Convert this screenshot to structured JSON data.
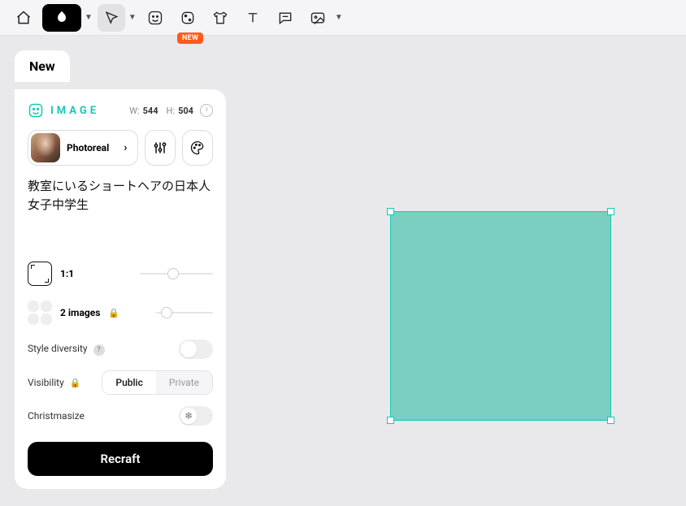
{
  "toolbar": {
    "new_badge": "NEW"
  },
  "tab": {
    "label": "New"
  },
  "panel": {
    "mode_label": "IMAGE",
    "width_label": "W:",
    "width_value": "544",
    "height_label": "H:",
    "height_value": "504",
    "style_name": "Photoreal",
    "prompt": "教室にいるショートヘアの日本人女子中学生",
    "aspect_label": "1:1",
    "images_count_label": "2 images",
    "style_diversity_label": "Style diversity",
    "visibility_label": "Visibility",
    "visibility_options": {
      "public": "Public",
      "private": "Private"
    },
    "christmasize_label": "Christmasize",
    "action_label": "Recraft"
  },
  "canvas": {
    "color": "#7bcfc0"
  }
}
